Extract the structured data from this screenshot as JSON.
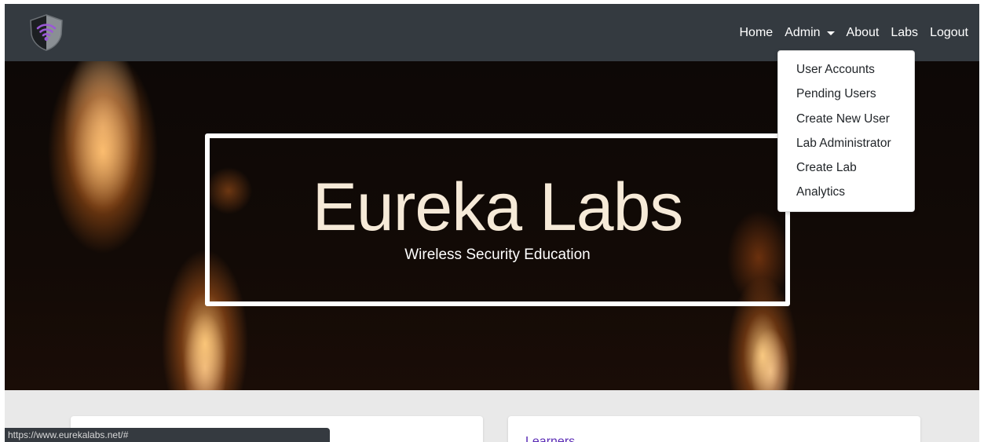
{
  "navbar": {
    "links": {
      "home": "Home",
      "admin": "Admin",
      "about": "About",
      "labs": "Labs",
      "logout": "Logout"
    },
    "logo_icon": "wifi-shield-logo-icon"
  },
  "admin_menu": {
    "items": [
      "User Accounts",
      "Pending Users",
      "Create New User",
      "Lab Administrator",
      "Create Lab",
      "Analytics"
    ]
  },
  "hero": {
    "title": "Eureka Labs",
    "subtitle": "Wireless Security Education"
  },
  "cards": {
    "right_title": "Learners"
  },
  "status_bar": {
    "url": "https://www.eurekalabs.net/#"
  },
  "colors": {
    "navbar_bg": "#343a40",
    "accent_purple": "#5a2bb5",
    "page_bg": "#e9e9e9"
  }
}
